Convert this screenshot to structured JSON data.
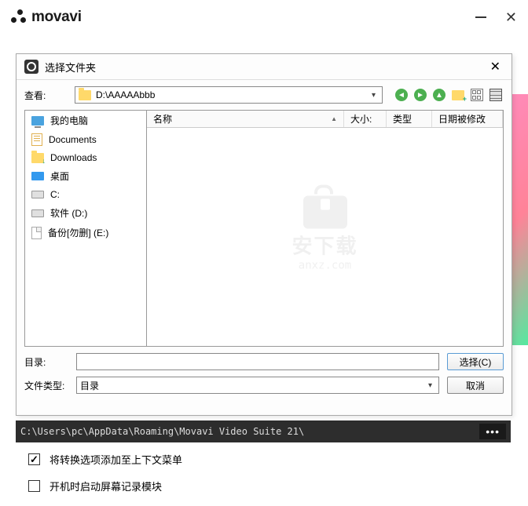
{
  "app": {
    "brand": "movavi"
  },
  "dialog": {
    "title": "选择文件夹",
    "lookin_label": "查看:",
    "path": "D:\\AAAAAbbb",
    "columns": {
      "name": "名称",
      "size": "大小:",
      "type": "类型",
      "date": "日期被修改"
    },
    "dir_label": "目录:",
    "dir_value": "",
    "filetype_label": "文件类型:",
    "filetype_value": "目录",
    "select_btn": "选择(C)",
    "cancel_btn": "取消"
  },
  "sidebar": {
    "items": [
      {
        "label": "我的电脑"
      },
      {
        "label": "Documents"
      },
      {
        "label": "Downloads"
      },
      {
        "label": "桌面"
      },
      {
        "label": "C:"
      },
      {
        "label": "软件 (D:)"
      },
      {
        "label": "备份[勿删] (E:)"
      }
    ]
  },
  "watermark": {
    "cn": "安下载",
    "en": "anxz.com"
  },
  "save_path": "C:\\Users\\pc\\AppData\\Roaming\\Movavi Video Suite 21\\",
  "options": {
    "context_menu": "将转换选项添加至上下文菜单",
    "startup_record": "开机时启动屏幕记录模块"
  }
}
